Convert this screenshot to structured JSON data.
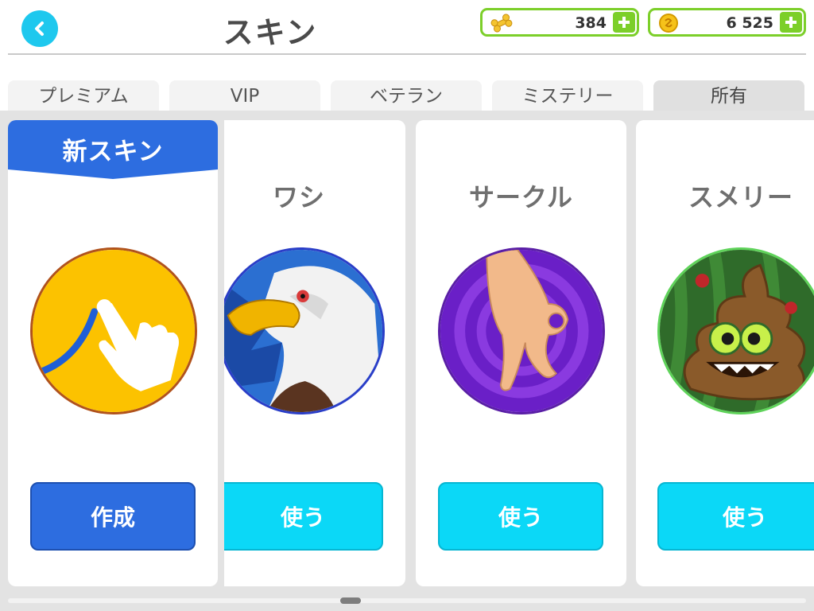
{
  "header": {
    "title": "スキン",
    "back_icon": "chevron-left-icon"
  },
  "currency": {
    "bones": {
      "icon": "bone-icon",
      "value": "384"
    },
    "coins": {
      "icon": "coin-icon",
      "value": "6 525"
    },
    "add_icon": "plus-icon"
  },
  "tabs": [
    {
      "label": "プレミアム",
      "active": false
    },
    {
      "label": "VIP",
      "active": false
    },
    {
      "label": "ベテラン",
      "active": false
    },
    {
      "label": "ミステリー",
      "active": false
    },
    {
      "label": "所有",
      "active": true
    }
  ],
  "cards": [
    {
      "banner": "新スキン",
      "image": "hand-draw-icon",
      "button": "作成"
    },
    {
      "title": "ワシ",
      "image": "eagle-avatar",
      "button": "使う"
    },
    {
      "title": "サークル",
      "image": "ok-hand-avatar",
      "button": "使う"
    },
    {
      "title": "スメリー",
      "image": "poop-avatar",
      "button": "使う"
    }
  ],
  "colors": {
    "accent_cyan": "#0bd8f7",
    "create_blue": "#2d6de0",
    "currency_green": "#7ccf2a",
    "banner_blue": "#2d6de0"
  }
}
